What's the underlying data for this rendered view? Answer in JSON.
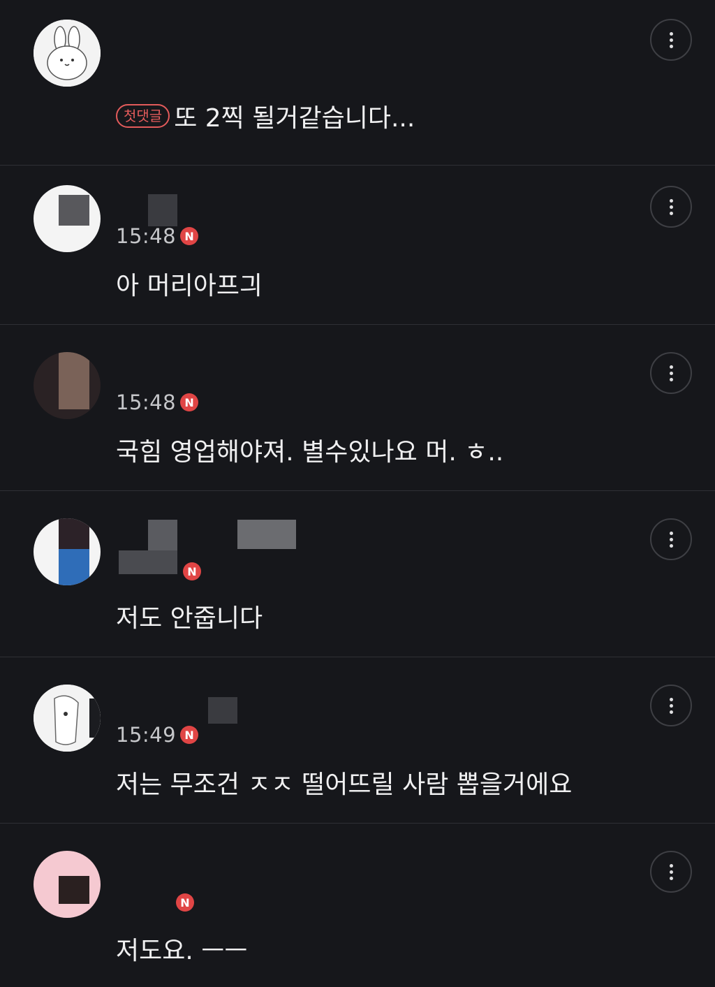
{
  "comments": [
    {
      "time": "",
      "has_n_badge": false,
      "first_badge": "첫댓글",
      "text": "또 2찍 될거같습니다..."
    },
    {
      "time": "15:48",
      "n_badge": "N",
      "text": "아 머리아프긔"
    },
    {
      "time": "15:48",
      "n_badge": "N",
      "text": "국힘 영업해야져. 별수있나요 머. ㅎ.."
    },
    {
      "time": "",
      "n_badge": "N",
      "text": "저도 안줍니다"
    },
    {
      "time": "15:49",
      "n_badge": "N",
      "text": "저는 무조건 ㅈㅈ 떨어뜨릴 사람 뽑을거에요"
    },
    {
      "time": "",
      "n_badge": "N",
      "text": "저도요. ㅡㅡ"
    }
  ],
  "colors": {
    "background": "#16171b",
    "divider": "#2f3035",
    "badge_red": "#e04545"
  },
  "icons": {
    "more": "more-vertical-icon"
  }
}
